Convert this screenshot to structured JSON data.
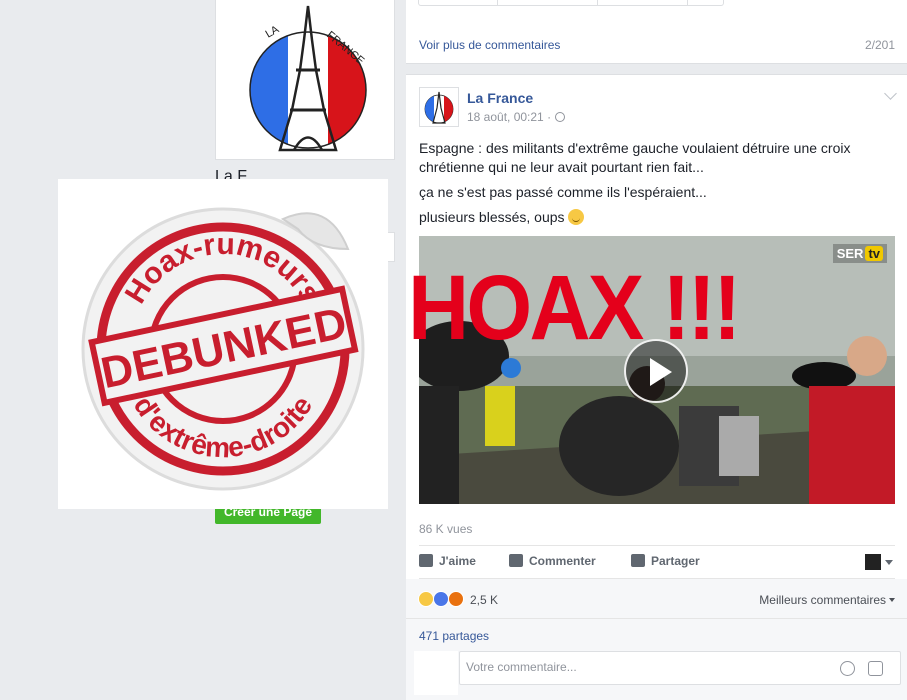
{
  "left": {
    "page_logo_text": "LA FRANCE",
    "name_partial": "La F...",
    "create_page_button": "Créer une Page"
  },
  "sticker": {
    "top_text": "Hoax-rumeurs",
    "center_text": "DEBUNKED",
    "bottom_text": "d'extrême-droite"
  },
  "comments_header": {
    "see_more": "Voir plus de commentaires",
    "count": "2/201"
  },
  "post": {
    "author": "La France",
    "date": "18 août, 00:21 ·",
    "text_lines": [
      "Espagne : des militants d'extrême gauche voulaient détruire une croix chrétienne qui ne leur avait pourtant rien fait...",
      "ça ne s'est pas passé comme ils l'espéraient...",
      "plusieurs blessés, oups"
    ],
    "video_logo": "SER",
    "video_logo_tv": "tv",
    "views": "86 K vues",
    "actions": {
      "like": "J'aime",
      "comment": "Commenter",
      "share": "Partager"
    },
    "reactions_count": "2,5 K",
    "best_comments": "Meilleurs commentaires",
    "shares": "471 partages",
    "comment_placeholder": "Votre commentaire..."
  },
  "overlay": {
    "hoax": "HOAX !!!"
  },
  "colors": {
    "link": "#365899",
    "hoax_red": "#e4001b",
    "green_button": "#42b72a",
    "background": "#e9ebee"
  }
}
